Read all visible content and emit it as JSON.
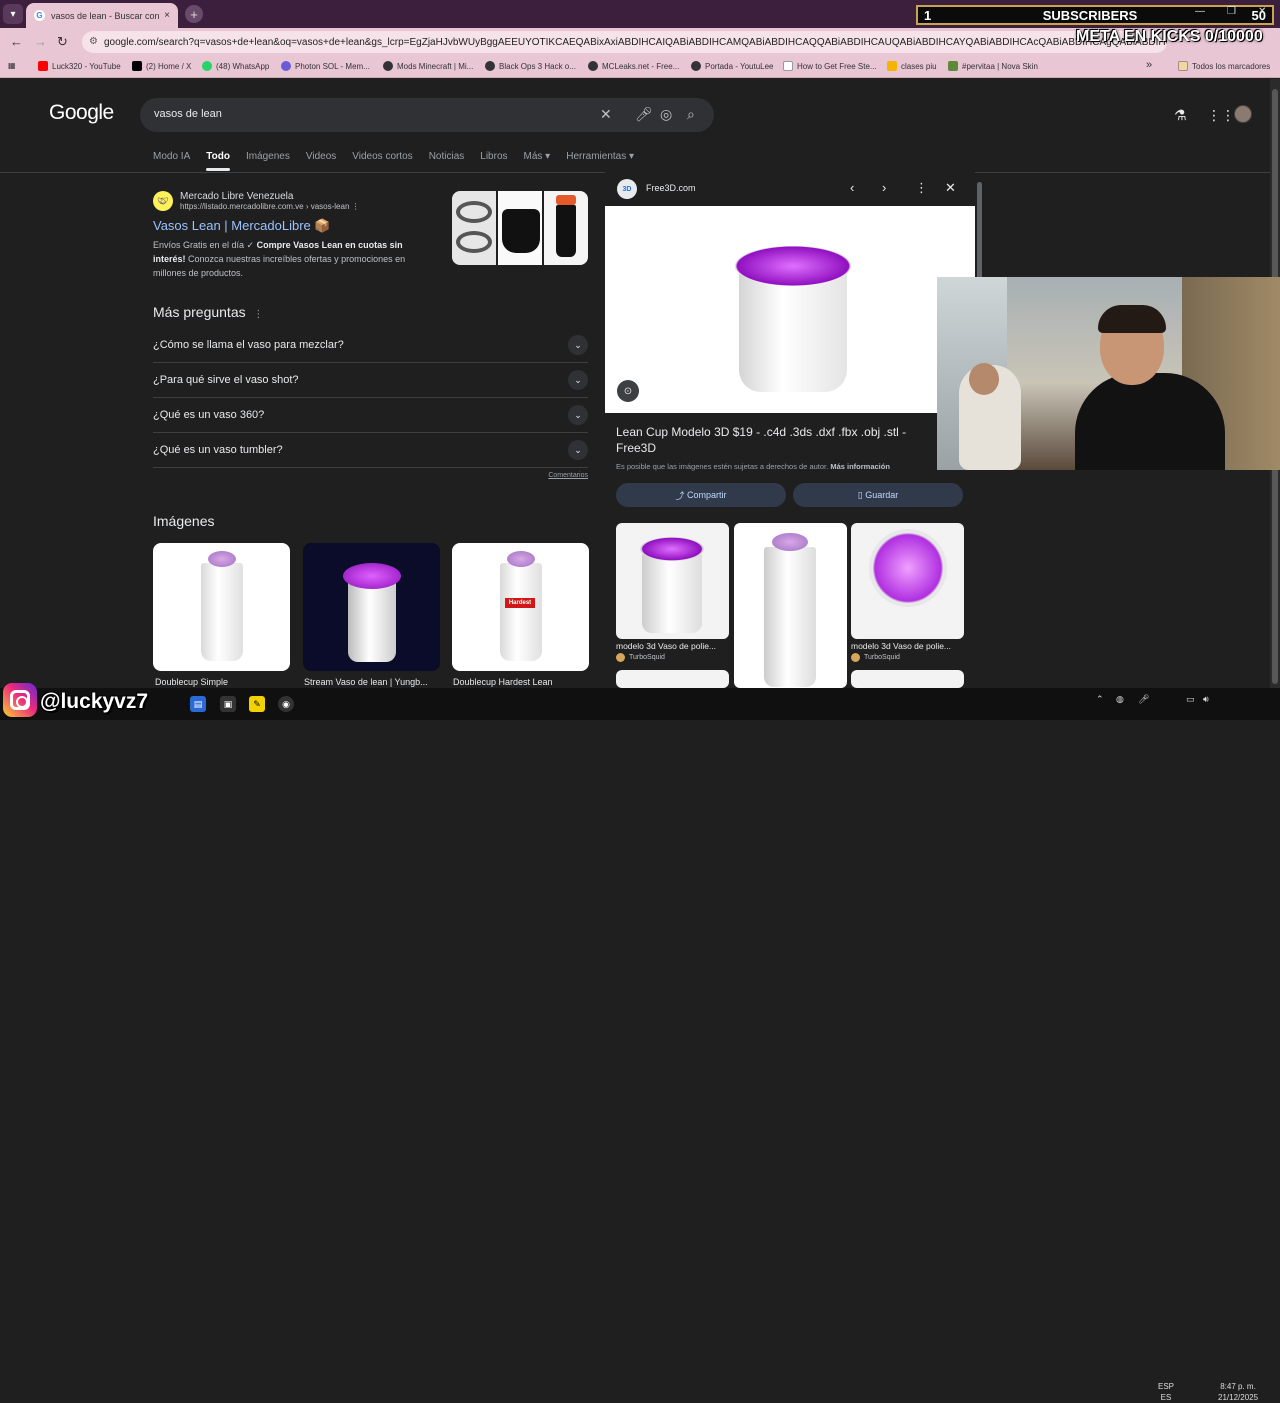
{
  "browser": {
    "tab_title": "vasos de lean - Buscar con Google",
    "tab_close": "×",
    "new_tab": "+",
    "url": "google.com/search?q=vasos+de+lean&oq=vasos+de+lean&gs_lcrp=EgZjaHJvbWUyBggAEEUYOTIKCAEQABixAxiABDIHCAIQABiABDIHCAMQABiABDIHCAQQABiABDIHCAUQABiABDIHCAYQABiABDIHCAcQABiABDIHCAgQABiABDIHCAkQ",
    "bookmarks": [
      "Luck320 - YouTube",
      "(2) Home / X",
      "(48) WhatsApp",
      "Photon SOL - Mem...",
      "Mods Minecraft | Mi...",
      "Black Ops 3 Hack o...",
      "MCLeaks.net - Free...",
      "Portada - YoutuLee",
      "How to Get Free Ste...",
      "clases piu",
      "#pervitaa | Nova Skin"
    ],
    "bookmarks_more": "»",
    "all_bookmarks": "Todos los marcadores"
  },
  "overlay": {
    "subs_current": "1",
    "subs_label": "SUBSCRIBERS",
    "subs_goal": "50",
    "meta_text": "META EN KICKS 0/10000",
    "handle": "@luckyvz7"
  },
  "google": {
    "logo": "Google",
    "query": "vasos de lean",
    "tabs": [
      "Modo IA",
      "Todo",
      "Imágenes",
      "Videos",
      "Videos cortos",
      "Noticias",
      "Libros",
      "Más ▾",
      "Herramientas ▾"
    ],
    "result": {
      "site_name": "Mercado Libre Venezuela",
      "cite": "https://listado.mercadolibre.com.ve › vasos-lean",
      "menu": "⋮",
      "title": "Vasos Lean | MercadoLibre 📦",
      "desc_1": "Envíos Gratis en el día ✓ ",
      "desc_bold": "Compre Vasos Lean en cuotas sin interés!",
      "desc_2": " Conozca nuestras increíbles ofertas y promociones en millones de productos."
    },
    "paa": {
      "heading": "Más preguntas",
      "menu": "⋮",
      "questions": [
        "¿Cómo se llama el vaso para mezclar?",
        "¿Para qué sirve el vaso shot?",
        "¿Qué es un vaso 360?",
        "¿Qué es un vaso tumbler?"
      ],
      "comments": "Comentarios"
    },
    "images": {
      "heading": "Imágenes",
      "cards": [
        "Doublecup Simple",
        "Stream Vaso de lean | Yungb...",
        "Doublecup Hardest Lean"
      ],
      "hardest_label": "Hardest"
    },
    "panel": {
      "source": "Free3D.com",
      "source_badge": "3D",
      "title": "Lean Cup Modelo 3D $19 - .c4d .3ds .dxf .fbx .obj .stl - Free3D",
      "note": "Es posible que las imágenes estén sujetas a derechos de autor.",
      "note_link": "Más información",
      "share": "Compartir",
      "save": "Guardar",
      "related": [
        {
          "caption": "modelo 3d Vaso de polie...",
          "source": "TurboSquid"
        },
        {
          "caption": "",
          "source": ""
        },
        {
          "caption": "modelo 3d Vaso de polie...",
          "source": "TurboSquid"
        }
      ]
    }
  },
  "taskbar": {
    "lang_1": "ESP",
    "lang_2": "ES",
    "time": "8:47 p. m.",
    "date": "21/12/2025"
  },
  "colors": {
    "accent_tab": "#e9c6d3",
    "link_blue": "#99c3ff",
    "lean_purple": "#a020c8",
    "page_bg": "#1f1f1f"
  }
}
